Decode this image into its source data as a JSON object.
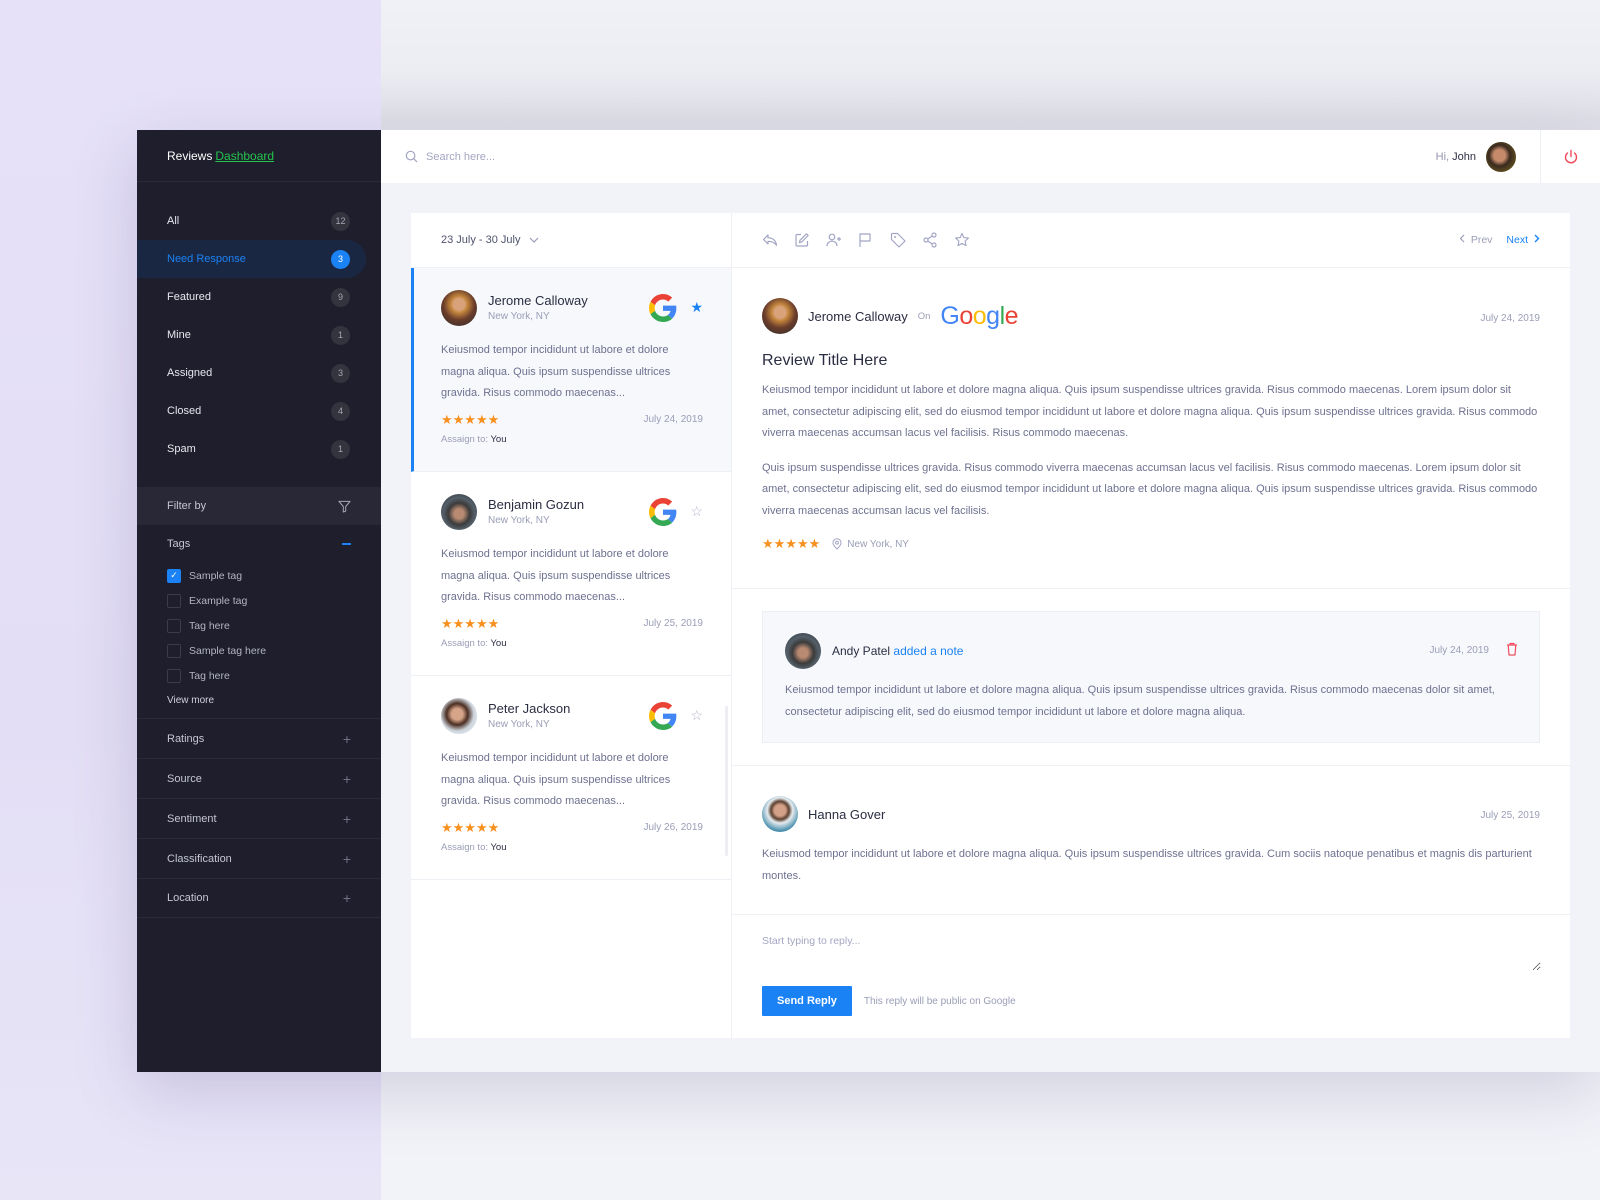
{
  "brand": {
    "prefix": "Reviews",
    "accent": "Dashboard"
  },
  "colors": {
    "accent": "#1a82f5",
    "brand_green": "#25c44d",
    "star": "#f7901e",
    "danger": "#ef4b5b",
    "sidebar_bg": "#1e1e2d"
  },
  "sidebar": {
    "items": [
      {
        "label": "All",
        "count": "12"
      },
      {
        "label": "Need Response",
        "count": "3",
        "active": true
      },
      {
        "label": "Featured",
        "count": "9"
      },
      {
        "label": "Mine",
        "count": "1"
      },
      {
        "label": "Assigned",
        "count": "3"
      },
      {
        "label": "Closed",
        "count": "4"
      },
      {
        "label": "Spam",
        "count": "1"
      }
    ],
    "filter_label": "Filter by",
    "tags_label": "Tags",
    "tags": [
      {
        "label": "Sample tag",
        "checked": true
      },
      {
        "label": "Example tag",
        "checked": false
      },
      {
        "label": "Tag here",
        "checked": false
      },
      {
        "label": "Sample tag here",
        "checked": false
      },
      {
        "label": "Tag here",
        "checked": false
      }
    ],
    "view_more": "View more",
    "sections": [
      "Ratings",
      "Source",
      "Sentiment",
      "Classification",
      "Location"
    ]
  },
  "topbar": {
    "search_placeholder": "Search here...",
    "greeting": "Hi,",
    "user": "John"
  },
  "list": {
    "date_range": "23 July - 30 July",
    "reviews": [
      {
        "name": "Jerome Calloway",
        "location": "New York, NY",
        "text": "Keiusmod tempor incididunt ut labore et dolore magna aliqua. Quis ipsum suspendisse ultrices gravida. Risus commodo maecenas...",
        "rating": 5,
        "stars": "★★★★★",
        "date": "July 24, 2019",
        "assign_label": "Assaign to:",
        "assignee": "You",
        "starred": true
      },
      {
        "name": "Benjamin Gozun",
        "location": "New York, NY",
        "text": "Keiusmod tempor incididunt ut labore et dolore magna aliqua. Quis ipsum suspendisse ultrices gravida. Risus commodo maecenas...",
        "rating": 5,
        "stars": "★★★★★",
        "date": "July 25, 2019",
        "assign_label": "Assaign to:",
        "assignee": "You",
        "starred": false
      },
      {
        "name": "Peter Jackson",
        "location": "New York, NY",
        "text": "Keiusmod tempor incididunt ut labore et dolore magna aliqua. Quis ipsum suspendisse ultrices gravida. Risus commodo maecenas...",
        "rating": 5,
        "stars": "★★★★★",
        "date": "July 26, 2019",
        "assign_label": "Assaign to:",
        "assignee": "You",
        "starred": false
      }
    ]
  },
  "detail": {
    "prev": "Prev",
    "next": "Next",
    "reviewer": "Jerome Calloway",
    "on": "On",
    "source": "Google",
    "date": "July 24, 2019",
    "title": "Review Title Here",
    "paragraphs": [
      "Keiusmod tempor incididunt ut labore et dolore magna aliqua. Quis ipsum suspendisse ultrices gravida. Risus commodo maecenas. Lorem ipsum dolor sit amet, consectetur adipiscing elit, sed do eiusmod tempor incididunt ut labore et dolore magna aliqua. Quis ipsum suspendisse ultrices gravida. Risus commodo viverra maecenas accumsan lacus vel facilisis. Risus commodo maecenas.",
      "Quis ipsum suspendisse ultrices gravida. Risus commodo viverra maecenas accumsan lacus vel facilisis. Risus commodo maecenas. Lorem ipsum dolor sit amet, consectetur adipiscing elit, sed do eiusmod tempor incididunt ut labore et dolore magna aliqua. Quis ipsum suspendisse ultrices gravida. Risus commodo viverra maecenas accumsan lacus vel facilisis."
    ],
    "rating": 5,
    "stars": "★★★★★",
    "location": "New York, NY",
    "note": {
      "author": "Andy Patel",
      "action": "added a note",
      "date": "July 24, 2019",
      "text": "Keiusmod tempor incididunt ut labore et dolore magna aliqua. Quis ipsum suspendisse ultrices gravida. Risus commodo maecenas dolor sit amet, consectetur adipiscing elit, sed do eiusmod tempor incididunt ut labore et dolore magna aliqua."
    },
    "comment": {
      "author": "Hanna Gover",
      "date": "July 25, 2019",
      "text": "Keiusmod tempor incididunt ut labore et dolore magna aliqua. Quis ipsum suspendisse ultrices gravida. Cum sociis natoque penatibus et magnis dis parturient montes."
    },
    "reply": {
      "placeholder": "Start typing to reply...",
      "send_label": "Send Reply",
      "public_note": "This reply will be public on Google"
    }
  }
}
